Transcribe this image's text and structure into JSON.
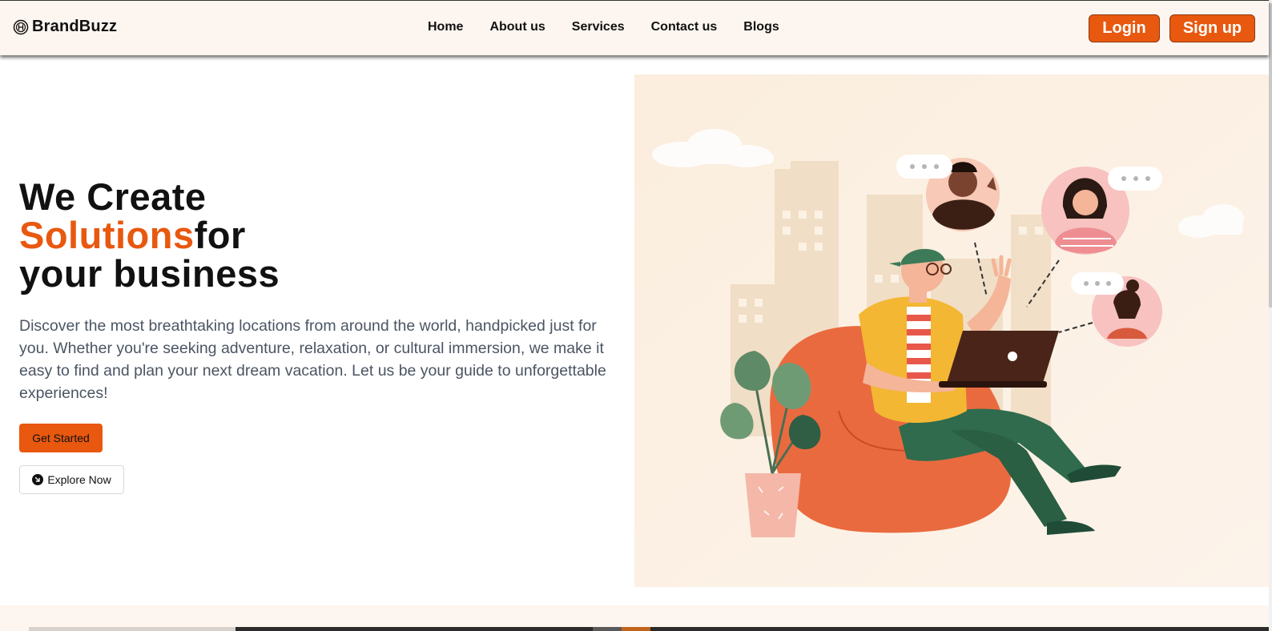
{
  "brand": {
    "name": "BrandBuzz",
    "icon": "brand-logo-icon"
  },
  "nav": {
    "links": [
      "Home",
      "About us",
      "Services",
      "Contact us",
      "Blogs"
    ],
    "login_label": "Login",
    "signup_label": "Sign up"
  },
  "hero": {
    "title_line1": "We Create",
    "title_accent": "Solutions",
    "title_after_accent": "for",
    "title_line3": "your business",
    "description": "Discover the most breathtaking locations from around the world, handpicked just for you. Whether you're seeking adventure, relaxation, or cultural immersion, we make it easy to find and plan your next dream vacation. Let us be your guide to unforgettable experiences!",
    "primary_button": "Get Started",
    "secondary_button": "Explore Now",
    "secondary_icon": "arrow-circle-icon",
    "illustration": "person-on-beanbag-with-laptop-chatting-illustration"
  },
  "colors": {
    "accent": "#e8580f",
    "nav_bg": "#fdf5ef",
    "illustration_bg": "#fcefdf",
    "text_muted": "#4b5563"
  }
}
